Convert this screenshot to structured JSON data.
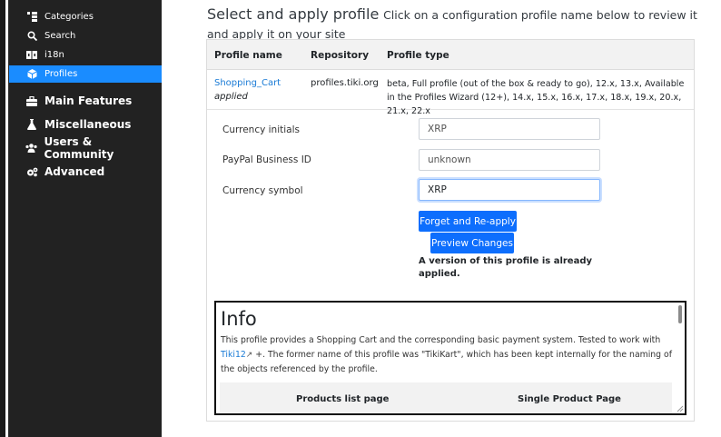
{
  "sidebar": {
    "sub_items": [
      {
        "label": "Categories",
        "icon": "categories-icon"
      },
      {
        "label": "Search",
        "icon": "search-icon"
      },
      {
        "label": "i18n",
        "icon": "language-icon"
      },
      {
        "label": "Profiles",
        "icon": "profiles-icon",
        "active": true
      }
    ],
    "main_items": [
      {
        "label": "Main Features",
        "icon": "briefcase-icon"
      },
      {
        "label": "Miscellaneous",
        "icon": "flask-icon"
      },
      {
        "label": "Users & Community",
        "icon": "users-icon"
      },
      {
        "label": "Advanced",
        "icon": "cogs-icon"
      }
    ]
  },
  "header": {
    "title": "Select and apply profile",
    "description": "Click on a configuration profile name below to review it and apply it on your site"
  },
  "table": {
    "columns": [
      "Profile name",
      "Repository",
      "Profile type"
    ],
    "row": {
      "name": "Shopping_Cart",
      "status": "applied",
      "repository": "profiles.tiki.org",
      "type": "beta, Full profile (out of the box & ready to go), 12.x, 13.x, Available in the Profiles Wizard (12+), 14.x, 15.x, 16.x, 17.x, 18.x, 19.x, 20.x, 21.x, 22.x"
    }
  },
  "form": {
    "currency_initials": {
      "label": "Currency initials",
      "value": "XRP"
    },
    "paypal_id": {
      "label": "PayPal Business ID",
      "value": "unknown"
    },
    "currency_symbol": {
      "label": "Currency symbol",
      "value": "XRP"
    },
    "forget_button": "Forget and Re-apply",
    "preview_button": "Preview Changes",
    "applied_note": "A version of this profile is already applied."
  },
  "info": {
    "title": "Info",
    "text_part1": "This profile provides a Shopping Cart and the corresponding basic payment system. Tested to work with ",
    "link": "Tiki12",
    "text_part2": "+. The former name of this profile was \"TikiKart\", which has been kept internally for the naming of the objects referenced by the profile.",
    "columns": [
      "Products list page",
      "Single Product Page"
    ]
  },
  "colors": {
    "sidebar_bg": "#222222",
    "active": "#1a8cff",
    "primary": "#0d6efd",
    "link": "#1a7bd6"
  }
}
